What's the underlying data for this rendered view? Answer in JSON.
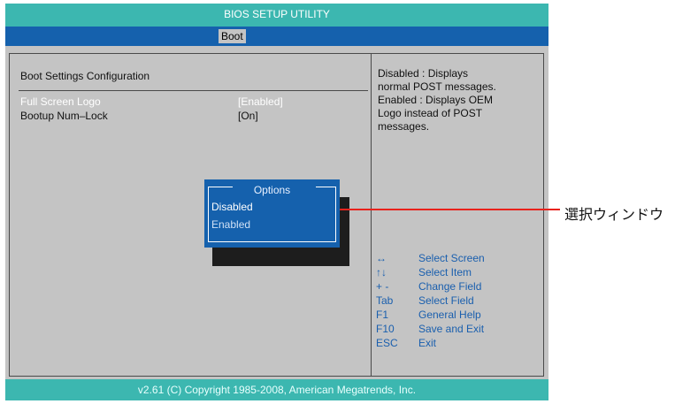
{
  "title": "BIOS SETUP UTILITY",
  "tabs": [
    {
      "label": "Boot",
      "active": true
    }
  ],
  "section_title": "Boot Settings Configuration",
  "settings": [
    {
      "label": "Full Screen Logo",
      "value": "[Enabled]",
      "highlighted": true
    },
    {
      "label": "Bootup Num–Lock",
      "value": "[On]",
      "highlighted": false
    }
  ],
  "help_lines": [
    "Disabled : Displays",
    "normal  POST  messages.",
    "Enabled : Displays OEM",
    "Logo  instead  of  POST",
    "messages."
  ],
  "popup": {
    "title": "Options",
    "options": [
      "Disabled",
      "Enabled"
    ],
    "selected": "Disabled"
  },
  "keys": [
    {
      "key": "↔",
      "desc": "Select Screen"
    },
    {
      "key": "↑↓",
      "desc": "Select Item"
    },
    {
      "key": "+ -",
      "desc": "Change Field"
    },
    {
      "key": "Tab",
      "desc": "Select Field"
    },
    {
      "key": "F1",
      "desc": "General Help"
    },
    {
      "key": "F10",
      "desc": "Save and Exit"
    },
    {
      "key": "ESC",
      "desc": "Exit"
    }
  ],
  "footer": "v2.61  (C) Copyright 1985-2008,  American  Megatrends,  Inc.",
  "callout": "選択ウィンドウ",
  "colors": {
    "title_bar": "#3cb7b0",
    "tab_bar": "#1561ad",
    "screen_bg": "#c4c4c4",
    "key_text": "#1a5fae",
    "popup_bg": "#1561ad",
    "callout_line": "#e8221c"
  }
}
